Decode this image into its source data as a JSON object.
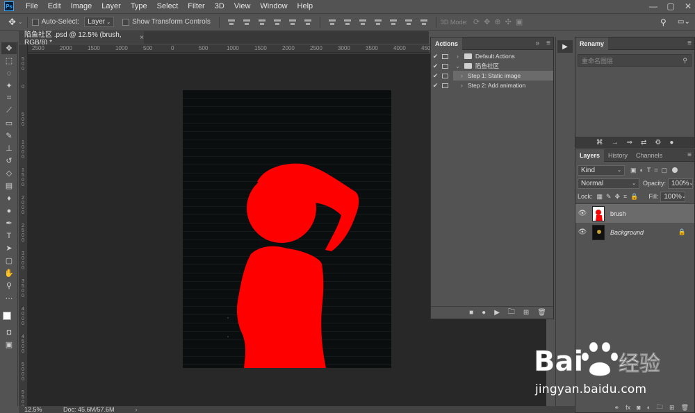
{
  "menubar": {
    "logo": "Ps",
    "items": [
      "File",
      "Edit",
      "Image",
      "Layer",
      "Type",
      "Select",
      "Filter",
      "3D",
      "View",
      "Window",
      "Help"
    ],
    "win_controls": [
      "—",
      "▢",
      "✕"
    ]
  },
  "options": {
    "auto_select_label": "Auto-Select:",
    "auto_select_value": "Layer",
    "show_transform_label": "Show Transform Controls",
    "mode_3d_label": "3D Mode:"
  },
  "document": {
    "tab_title": "陷鱼社区 .psd @ 12.5% (brush, RGB/8) *",
    "tab_close": "×",
    "zoom": "12.5%",
    "doc_size": "Doc: 45.6M/57.6M",
    "canvas_bg": "#0b0e0f",
    "figure_color": "#ff0000"
  },
  "rulers": {
    "top": [
      "2500",
      "2000",
      "1500",
      "1000",
      "500",
      "0",
      "500",
      "1000",
      "1500",
      "2000",
      "2500",
      "3000",
      "3500",
      "4000",
      "4500"
    ],
    "left": [
      "500",
      "0",
      "500",
      "1000",
      "1500",
      "2000",
      "2500",
      "3000",
      "3500",
      "4000",
      "4500",
      "5000",
      "5500"
    ]
  },
  "actions_panel": {
    "tab": "Actions",
    "collapse_icon": "»",
    "menu_icon": "≡",
    "rows": [
      {
        "arrow": "›",
        "label": "Default Actions",
        "type": "set"
      },
      {
        "arrow": "⌄",
        "label": "陷鱼社区",
        "type": "set"
      },
      {
        "arrow": "›",
        "label": "Step 1: Static image",
        "type": "action"
      },
      {
        "arrow": "›",
        "label": "Step 2: Add animation",
        "type": "action"
      }
    ],
    "footer_icons": [
      "■",
      "●",
      "▶",
      "🗀",
      "⊞",
      "🗑"
    ]
  },
  "renamy_panel": {
    "title": "Renamy",
    "search_placeholder": "重命名图层",
    "toolbar_icons": [
      "⌘",
      "→",
      "⇒",
      "⇄",
      "⚙",
      "●"
    ]
  },
  "layers_panel": {
    "tabs": [
      "Layers",
      "History",
      "Channels"
    ],
    "filter_label": "Kind",
    "blend_mode": "Normal",
    "opacity_label": "Opacity:",
    "opacity_value": "100%",
    "lock_label": "Lock:",
    "fill_label": "Fill:",
    "fill_value": "100%",
    "layers": [
      {
        "name": "brush",
        "visible": true,
        "selected": true,
        "locked": false
      },
      {
        "name": "Background",
        "visible": true,
        "selected": false,
        "locked": true
      }
    ],
    "footer_icons": [
      "⚭",
      "fx",
      "◙",
      "◐",
      "🗀",
      "⊞",
      "🗑"
    ]
  },
  "watermark": {
    "brand": "Bai",
    "brand2": "经验",
    "url": "jingyan.baidu.com"
  }
}
